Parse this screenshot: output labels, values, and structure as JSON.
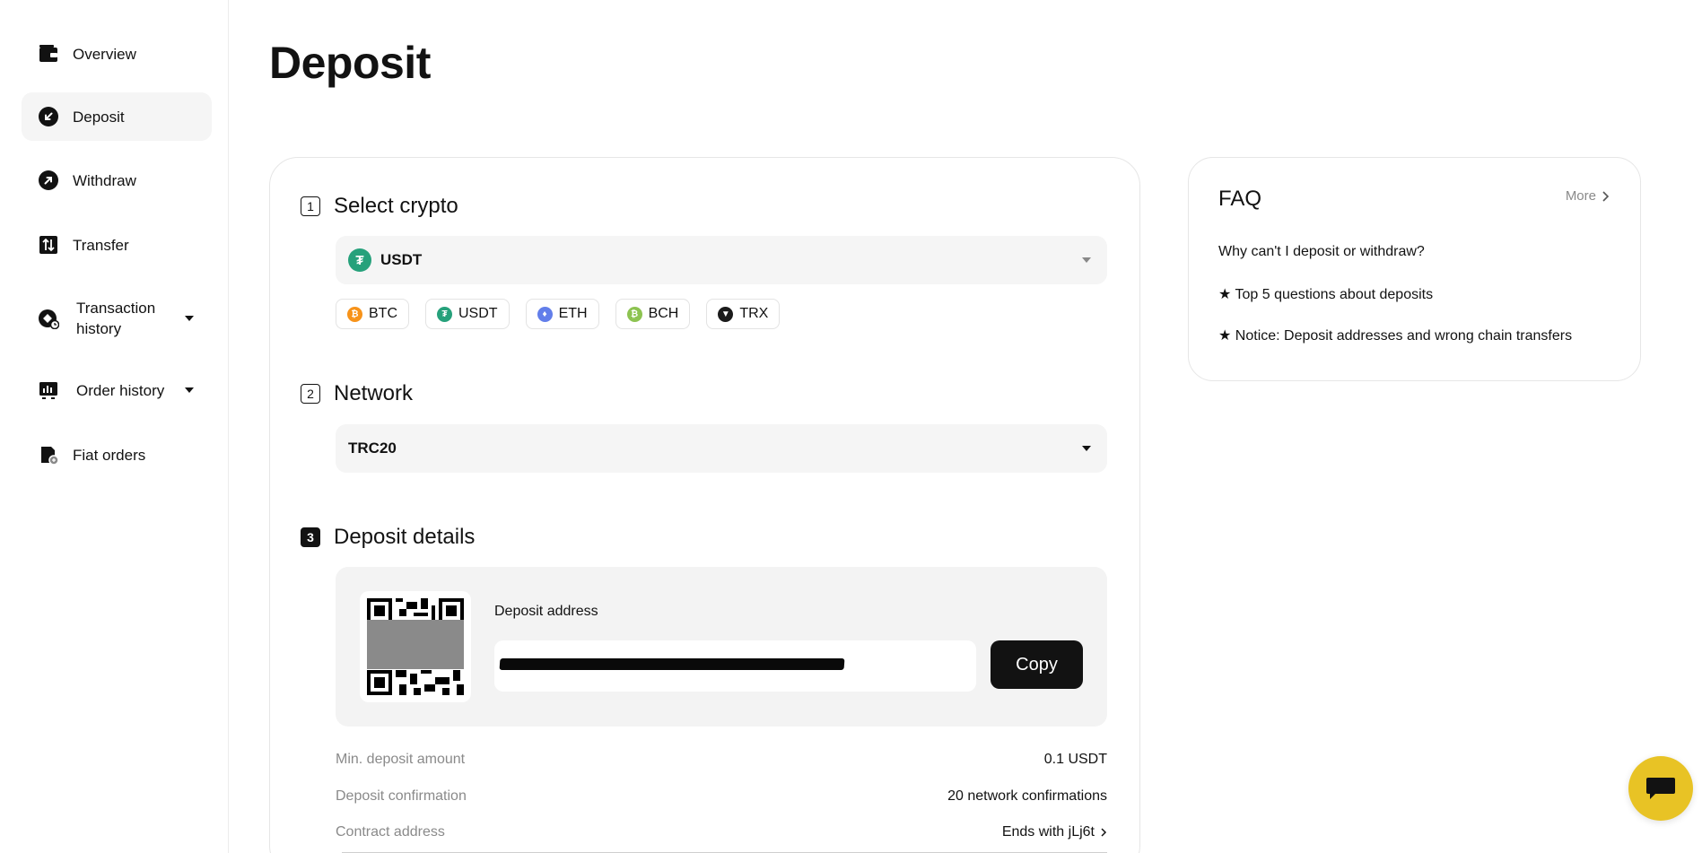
{
  "sidebar": {
    "items": [
      {
        "label": "Overview",
        "icon": "wallet-icon"
      },
      {
        "label": "Deposit",
        "icon": "deposit-arrow-icon",
        "active": true
      },
      {
        "label": "Withdraw",
        "icon": "withdraw-arrow-icon"
      },
      {
        "label": "Transfer",
        "icon": "transfer-icon"
      },
      {
        "label": "Transaction history",
        "icon": "transaction-history-icon",
        "expandable": true
      },
      {
        "label": "Order history",
        "icon": "order-history-icon",
        "expandable": true
      },
      {
        "label": "Fiat orders",
        "icon": "fiat-orders-icon"
      }
    ]
  },
  "page": {
    "title": "Deposit"
  },
  "steps": {
    "select_crypto": {
      "number": "1",
      "title": "Select crypto",
      "selected": "USDT",
      "quick_picks": [
        {
          "symbol": "BTC",
          "color": "#F7931A"
        },
        {
          "symbol": "USDT",
          "color": "#26A17B"
        },
        {
          "symbol": "ETH",
          "color": "#627EEA"
        },
        {
          "symbol": "BCH",
          "color": "#8DC351"
        },
        {
          "symbol": "TRX",
          "color": "#1b1b1b"
        }
      ]
    },
    "network": {
      "number": "2",
      "title": "Network",
      "selected": "TRC20"
    },
    "deposit_details": {
      "number": "3",
      "title": "Deposit details",
      "address_label": "Deposit address",
      "copy_label": "Copy",
      "rows": [
        {
          "key": "Min. deposit amount",
          "value": "0.1 USDT"
        },
        {
          "key": "Deposit confirmation",
          "value": "20 network confirmations"
        },
        {
          "key": "Contract address",
          "value": "Ends with jLj6t"
        }
      ]
    }
  },
  "faq": {
    "title": "FAQ",
    "more_label": "More",
    "items": [
      "Why can't I deposit or withdraw?",
      "★ Top 5 questions about deposits",
      "★ Notice: Deposit addresses and wrong chain transfers"
    ]
  },
  "colors": {
    "accent_chat": "#E8C325",
    "usdt": "#26A17B",
    "text": "#121212",
    "muted": "#8A8A8A"
  }
}
